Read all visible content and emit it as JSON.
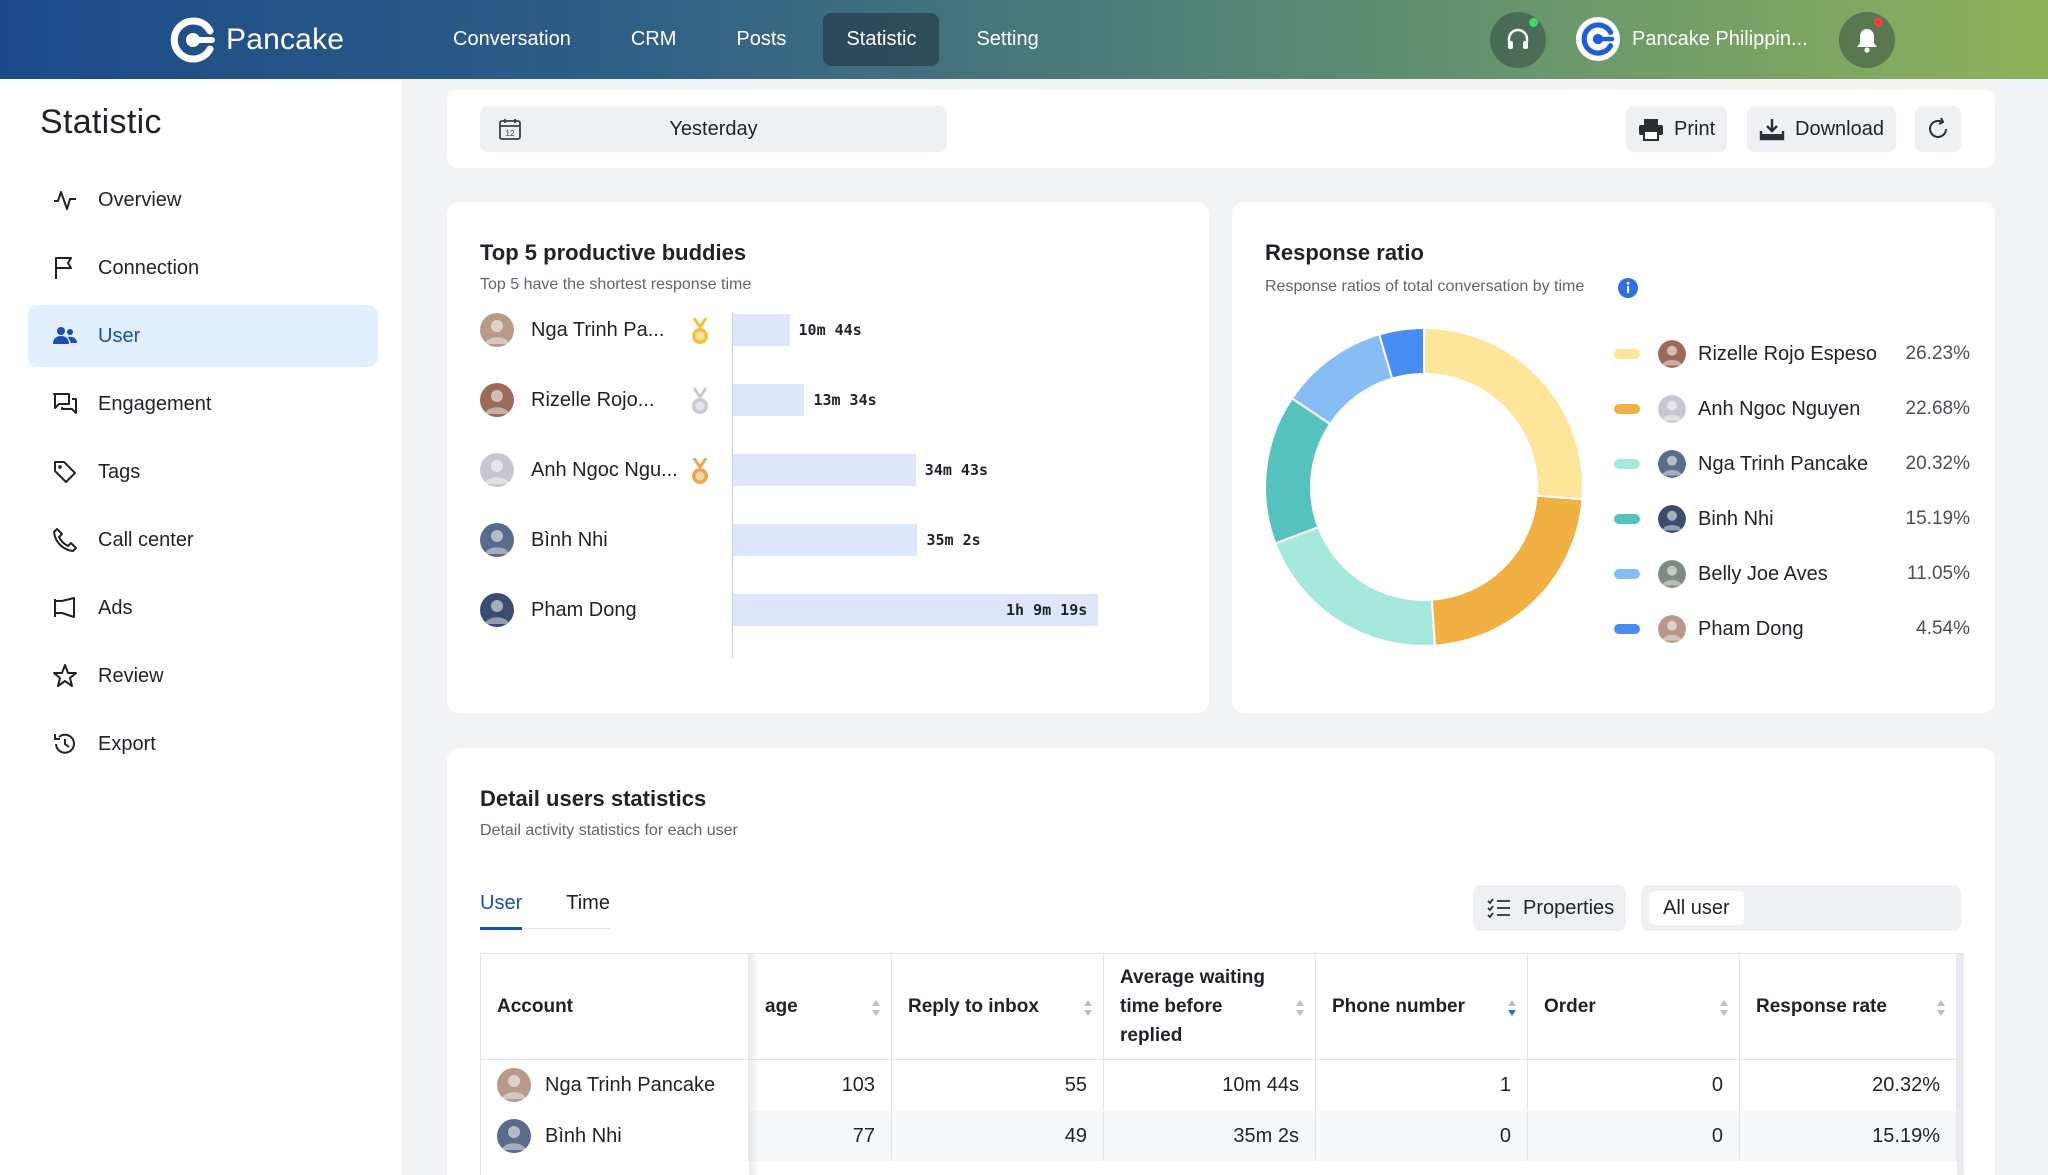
{
  "topbar": {
    "brand": "Pancake",
    "nav": [
      "Conversation",
      "CRM",
      "Posts",
      "Statistic",
      "Setting"
    ],
    "active_nav": "Statistic",
    "account_name": "Pancake Philippin..."
  },
  "sidebar": {
    "title": "Statistic",
    "items": [
      {
        "label": "Overview",
        "icon": "activity-icon"
      },
      {
        "label": "Connection",
        "icon": "flag-icon"
      },
      {
        "label": "User",
        "icon": "users-icon",
        "active": true
      },
      {
        "label": "Engagement",
        "icon": "chat-bubbles-icon"
      },
      {
        "label": "Tags",
        "icon": "tag-icon"
      },
      {
        "label": "Call center",
        "icon": "phone-icon"
      },
      {
        "label": "Ads",
        "icon": "megaphone-icon"
      },
      {
        "label": "Review",
        "icon": "star-icon"
      },
      {
        "label": "Export",
        "icon": "history-icon"
      }
    ]
  },
  "toolbar": {
    "date": "Yesterday",
    "print": "Print",
    "download": "Download"
  },
  "buddies": {
    "title": "Top 5 productive buddies",
    "subtitle": "Top 5 have the shortest response time",
    "rows": [
      {
        "name": "Nga Trinh Pa...",
        "time": "10m 44s",
        "seconds": 644,
        "medal": "gold"
      },
      {
        "name": "Rizelle Rojo...",
        "time": "13m 34s",
        "seconds": 814,
        "medal": "silver"
      },
      {
        "name": "Anh Ngoc Ngu...",
        "time": "34m 43s",
        "seconds": 2083,
        "medal": "bronze"
      },
      {
        "name": "Bình Nhi",
        "time": "35m 2s",
        "seconds": 2102,
        "medal": ""
      },
      {
        "name": "Pham Dong",
        "time": "1h 9m 19s",
        "seconds": 4159,
        "medal": ""
      }
    ]
  },
  "response_ratio": {
    "title": "Response ratio",
    "subtitle": "Response ratios of total conversation by time"
  },
  "chart_data": {
    "type": "pie",
    "categories": [
      "Rizelle Rojo Espeso",
      "Anh Ngoc Nguyen",
      "Nga Trinh Pancake",
      "Binh Nhi",
      "Belly Joe Aves",
      "Pham Dong"
    ],
    "values": [
      26.23,
      22.68,
      20.32,
      15.19,
      11.05,
      4.54
    ],
    "labels": [
      "26.23%",
      "22.68%",
      "20.32%",
      "15.19%",
      "11.05%",
      "4.54%"
    ],
    "colors": [
      "#fde59a",
      "#f0b042",
      "#a6e8dc",
      "#56c2be",
      "#85bdf4",
      "#4a8df0"
    ],
    "legend_position": "right"
  },
  "details": {
    "title": "Detail users statistics",
    "subtitle": "Detail activity statistics for each user",
    "tabs": [
      "User",
      "Time"
    ],
    "properties": "Properties",
    "user_filter": "All user",
    "columns": [
      "Account",
      "age",
      "Reply to inbox",
      "Average waiting time before replied",
      "Phone number",
      "Order",
      "Response rate"
    ],
    "rows": [
      {
        "account": "Nga Trinh Pancake",
        "cells": [
          "103",
          "55",
          "10m 44s",
          "1",
          "0",
          "20.32%"
        ]
      },
      {
        "account": "Bình Nhi",
        "cells": [
          "77",
          "49",
          "35m 2s",
          "0",
          "0",
          "15.19%"
        ]
      }
    ]
  }
}
